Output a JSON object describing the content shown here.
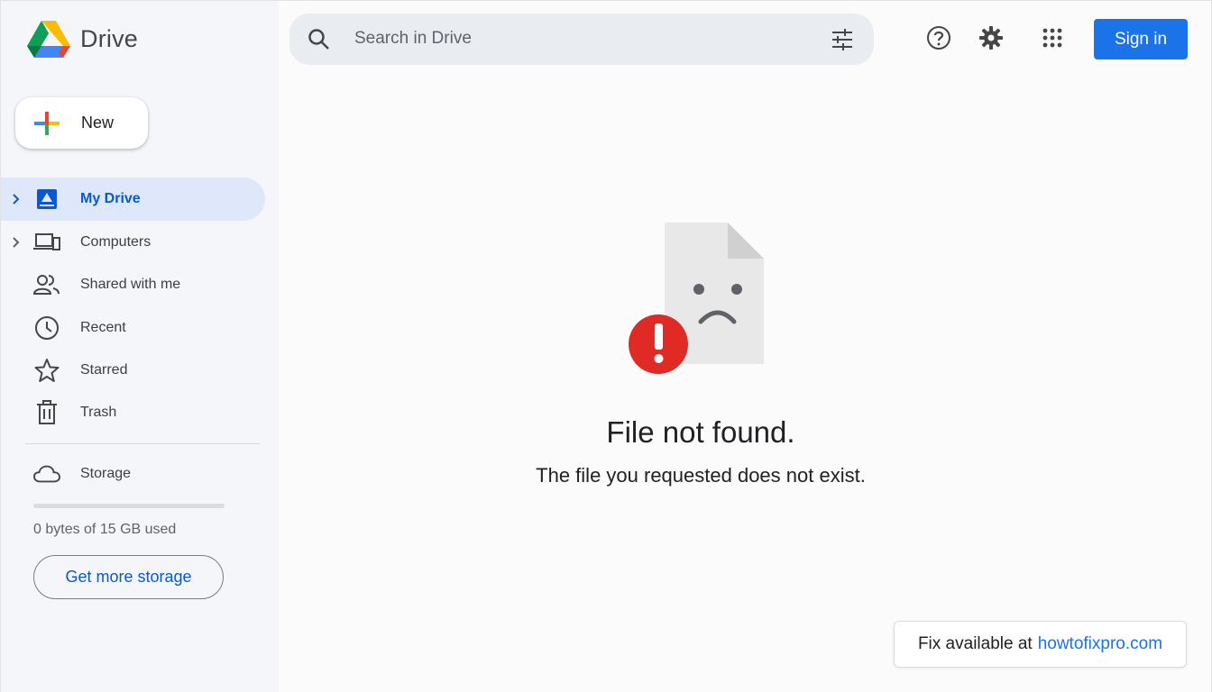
{
  "app": {
    "name": "Drive"
  },
  "sidebar": {
    "new_label": "New",
    "items": [
      {
        "label": "My Drive",
        "icon": "my-drive-icon",
        "active": true,
        "expandable": true
      },
      {
        "label": "Computers",
        "icon": "computers-icon",
        "active": false,
        "expandable": true
      },
      {
        "label": "Shared with me",
        "icon": "shared-with-me-icon",
        "active": false,
        "expandable": false
      },
      {
        "label": "Recent",
        "icon": "clock-icon",
        "active": false,
        "expandable": false
      },
      {
        "label": "Starred",
        "icon": "star-icon",
        "active": false,
        "expandable": false
      },
      {
        "label": "Trash",
        "icon": "trash-icon",
        "active": false,
        "expandable": false
      }
    ],
    "storage": {
      "label": "Storage",
      "icon": "cloud-icon",
      "usage_text": "0 bytes of 15 GB used",
      "used_fraction": 0,
      "cta_label": "Get more storage"
    }
  },
  "header": {
    "search_placeholder": "Search in Drive",
    "icons": [
      "help-icon",
      "settings-icon",
      "apps-grid-icon"
    ],
    "signin_label": "Sign in"
  },
  "error": {
    "title": "File not found.",
    "subtitle": "The file you requested does not exist."
  },
  "fix_notice": {
    "prefix": "Fix available at",
    "link_text": "howtofixpro.com"
  },
  "colors": {
    "accent": "#0b57d0",
    "signin_button": "#1a73e8",
    "active_nav_bg": "#dfe8fb",
    "error_red": "#e02a26"
  }
}
